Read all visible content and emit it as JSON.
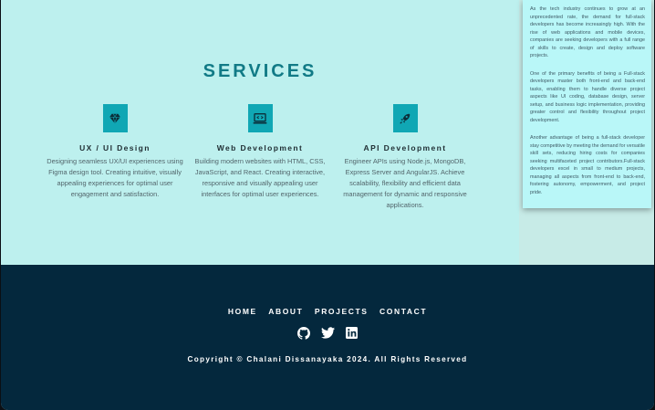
{
  "services": {
    "title": "SERVICES",
    "cards": [
      {
        "icon": "diamond-icon",
        "title": "UX / UI Design",
        "text": "Designing seamless UX/UI experiences using Figma design tool. Creating intuitive, visually appealing experiences for optimal user engagement and satisfaction."
      },
      {
        "icon": "laptop-code-icon",
        "title": "Web Development",
        "text": "Building modern websites with HTML, CSS, JavaScript, and React. Creating interactive, responsive and visually appealing user interfaces for optimal user experiences."
      },
      {
        "icon": "rocket-icon",
        "title": "API Development",
        "text": "Engineer APIs using Node.js, MongoDB, Express Server and AngularJS. Achieve scalability, flexibility and efficient data management for dynamic and responsive applications."
      }
    ]
  },
  "popup": {
    "paragraphs": [
      "As the tech industry continues to grow at an unprecedented rate, the demand for full-stack developers has become increasingly high. With the rise of web applications and mobile devices, companies are seeking developers with a full range of skills to create, design and deploy software projects.",
      "One of the primary benefits of being a Full-stack developers master both front-end and back-end tasks, enabling them to handle diverse project aspects like UI coding, database design, server setup, and business logic implementation, providing greater control and flexibility throughout project development.",
      "Another advantage of being a full-stack developer stay competitive by meeting the demand for versatile skill sets, reducing hiring costs for companies seeking multifaceted project contributors.Full-stack developers excel in small to medium projects, managing all aspects from front-end to back-end, fostering autonomy, empowerment, and project pride."
    ]
  },
  "footer": {
    "nav": [
      "HOME",
      "ABOUT",
      "PROJECTS",
      "CONTACT"
    ],
    "social": [
      "github-icon",
      "twitter-icon",
      "linkedin-icon"
    ],
    "copyright": "Copyright © Chalani Dissanayaka 2024. All Rights Reserved"
  },
  "colors": {
    "accent": "#10a7b4",
    "title": "#117a86",
    "footer_bg": "#04283d",
    "services_bg": "#bdf0ee"
  }
}
